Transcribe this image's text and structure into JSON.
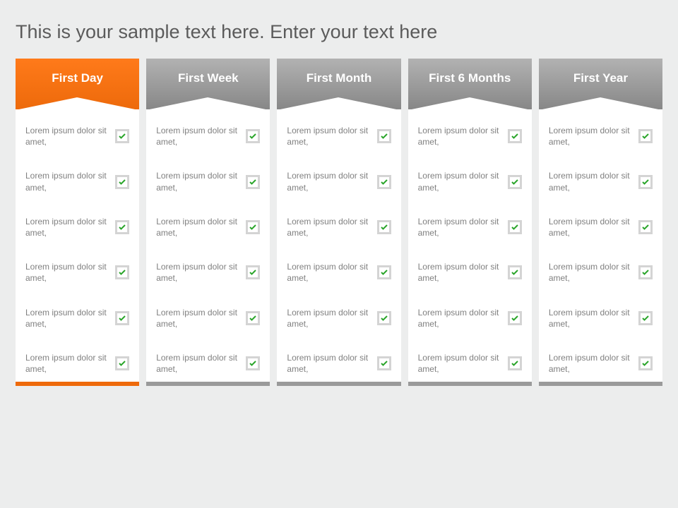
{
  "title": "This is your sample text here. Enter your text here",
  "item_text": "Lorem ipsum dolor sit amet,",
  "columns": [
    {
      "label": "First Day",
      "active": true,
      "items": 6
    },
    {
      "label": "First Week",
      "active": false,
      "items": 6
    },
    {
      "label": "First Month",
      "active": false,
      "items": 6
    },
    {
      "label": "First 6 Months",
      "active": false,
      "items": 6
    },
    {
      "label": "First Year",
      "active": false,
      "items": 6
    }
  ],
  "colors": {
    "accent": "#ee6a0b",
    "check": "#2aa52a"
  }
}
